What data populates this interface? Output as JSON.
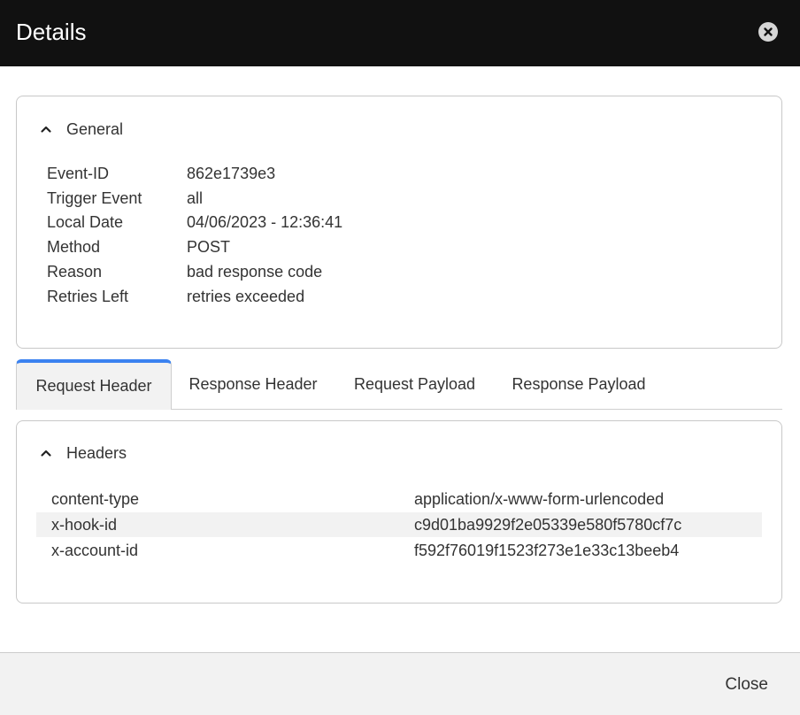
{
  "dialog": {
    "title": "Details",
    "close_icon": "close-circle-icon"
  },
  "general": {
    "label": "General",
    "toggle_icon": "chevron-up-icon",
    "fields": [
      {
        "key": "Event-ID",
        "value": "862e1739e3"
      },
      {
        "key": "Trigger Event",
        "value": "all"
      },
      {
        "key": "Local Date",
        "value": "04/06/2023 - 12:36:41"
      },
      {
        "key": "Method",
        "value": "POST"
      },
      {
        "key": "Reason",
        "value": "bad response code"
      },
      {
        "key": "Retries Left",
        "value": "retries exceeded"
      }
    ]
  },
  "tabs": [
    {
      "label": "Request Header",
      "active": true
    },
    {
      "label": "Response Header",
      "active": false
    },
    {
      "label": "Request Payload",
      "active": false
    },
    {
      "label": "Response Payload",
      "active": false
    }
  ],
  "headers": {
    "label": "Headers",
    "toggle_icon": "chevron-up-icon",
    "rows": [
      {
        "key": "content-type",
        "value": "application/x-www-form-urlencoded"
      },
      {
        "key": "x-hook-id",
        "value": "c9d01ba9929f2e05339e580f5780cf7c"
      },
      {
        "key": "x-account-id",
        "value": "f592f76019f1523f273e1e33c13beeb4"
      }
    ]
  },
  "footer": {
    "close_label": "Close"
  },
  "colors": {
    "header_bg": "#111111",
    "accent": "#3b82f0",
    "footer_bg": "#f2f2f2"
  }
}
